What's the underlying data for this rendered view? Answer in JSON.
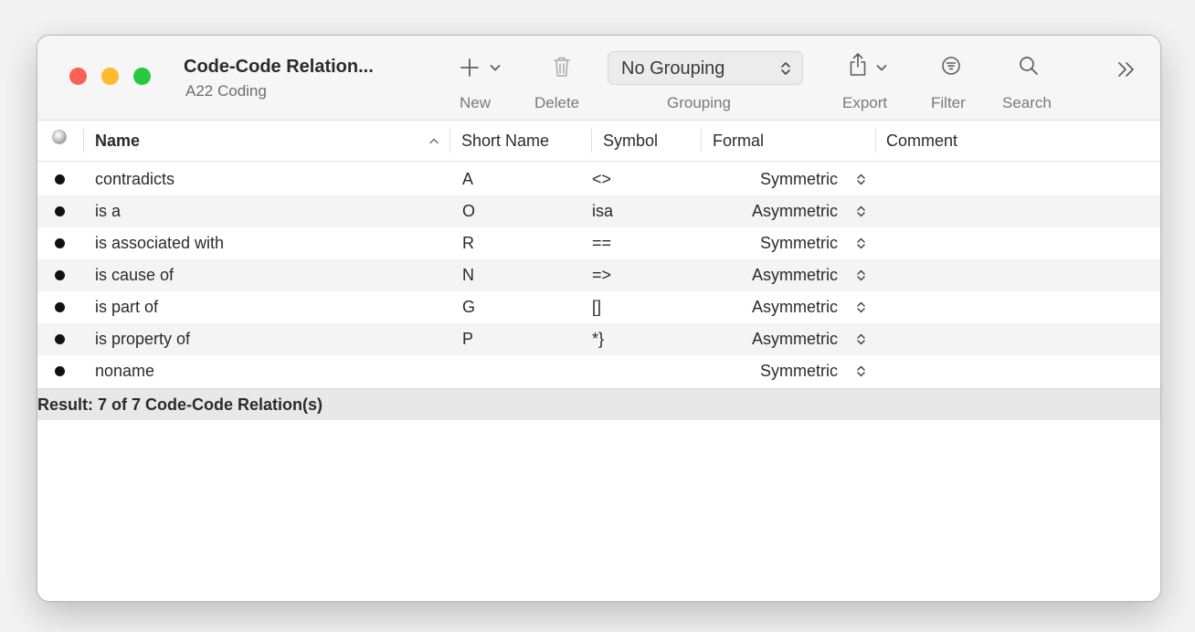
{
  "window": {
    "title": "Code-Code Relation...",
    "subtitle": "A22  Coding"
  },
  "toolbar": {
    "new_label": "New",
    "delete_label": "Delete",
    "grouping_label": "Grouping",
    "grouping_value": "No Grouping",
    "export_label": "Export",
    "filter_label": "Filter",
    "search_label": "Search",
    "new_icon": "plus-icon",
    "delete_icon": "trash-icon",
    "export_icon": "share-icon",
    "filter_icon": "filter-icon",
    "search_icon": "search-icon",
    "overflow_icon": "chevron-double-right-icon"
  },
  "table": {
    "columns": {
      "name": "Name",
      "short_name": "Short Name",
      "symbol": "Symbol",
      "formal": "Formal",
      "comment": "Comment"
    },
    "sort_indicator": "^",
    "rows": [
      {
        "name": "contradicts",
        "short_name": "A",
        "symbol": "<>",
        "formal": "Symmetric",
        "comment": ""
      },
      {
        "name": "is a",
        "short_name": "O",
        "symbol": "isa",
        "formal": "Asymmetric",
        "comment": ""
      },
      {
        "name": "is associated with",
        "short_name": "R",
        "symbol": "==",
        "formal": "Symmetric",
        "comment": ""
      },
      {
        "name": "is cause of",
        "short_name": "N",
        "symbol": "=>",
        "formal": "Asymmetric",
        "comment": ""
      },
      {
        "name": "is part of",
        "short_name": "G",
        "symbol": "[]",
        "formal": "Asymmetric",
        "comment": ""
      },
      {
        "name": "is property of",
        "short_name": "P",
        "symbol": "*}",
        "formal": "Asymmetric",
        "comment": ""
      },
      {
        "name": "noname",
        "short_name": "",
        "symbol": "",
        "formal": "Symmetric",
        "comment": ""
      }
    ]
  },
  "status": {
    "result": "Result: 7 of 7 Code-Code Relation(s)"
  },
  "colors": {
    "close": "#fe5f57",
    "minimize": "#fdbb2e",
    "zoom": "#28c840",
    "row_alt": "#f4f4f4",
    "status_bg": "#e8e8e8"
  }
}
